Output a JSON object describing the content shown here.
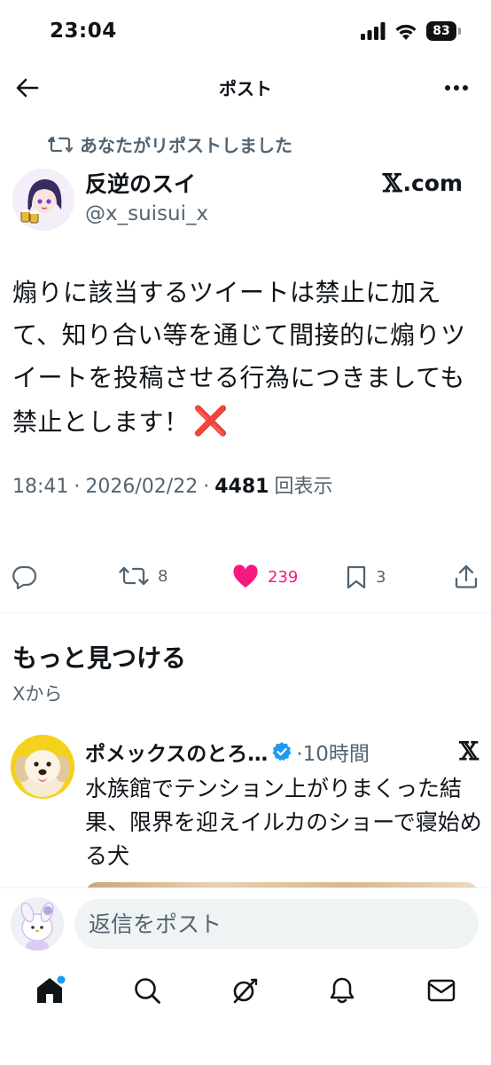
{
  "status_bar": {
    "time": "23:04",
    "battery": "83"
  },
  "header": {
    "title": "ポスト"
  },
  "repost_note": "あなたがリポストしました",
  "author": {
    "name": "反逆のスイ",
    "handle": "@x_suisui_x",
    "link_text": ".com",
    "link_brand": "𝕏"
  },
  "post": {
    "text": "煽りに該当するツイートは禁止に加えて、知り合い等を通じて間接的に煽りツイートを投稿させる行為につきましても禁止とします！",
    "emoji": "❌",
    "time": "18:41",
    "date": "2026/02/22",
    "views": "4481",
    "views_label": "回表示",
    "separator": "·"
  },
  "actions": {
    "reposts": "8",
    "likes": "239",
    "bookmarks": "3"
  },
  "discover": {
    "title": "もっと見つける",
    "subtitle": "Xから",
    "item": {
      "name": "ポメックスのとろ…",
      "time": "·10時間",
      "text": "水族館でテンション上がりまくった結果、限界を迎えイルカのショーで寝始める犬",
      "brand": "𝕏"
    }
  },
  "reply": {
    "placeholder": "返信をポスト"
  },
  "colors": {
    "like": "#f91880",
    "verified": "#1d9bf0",
    "muted": "#536471",
    "notification_dot": "#1d9bf0"
  },
  "icons": [
    "back-arrow-icon",
    "more-icon",
    "repost-icon",
    "reply-icon",
    "heart-icon",
    "bookmark-icon",
    "share-icon",
    "verified-icon",
    "home-icon",
    "search-icon",
    "grok-icon",
    "bell-icon",
    "mail-icon"
  ]
}
